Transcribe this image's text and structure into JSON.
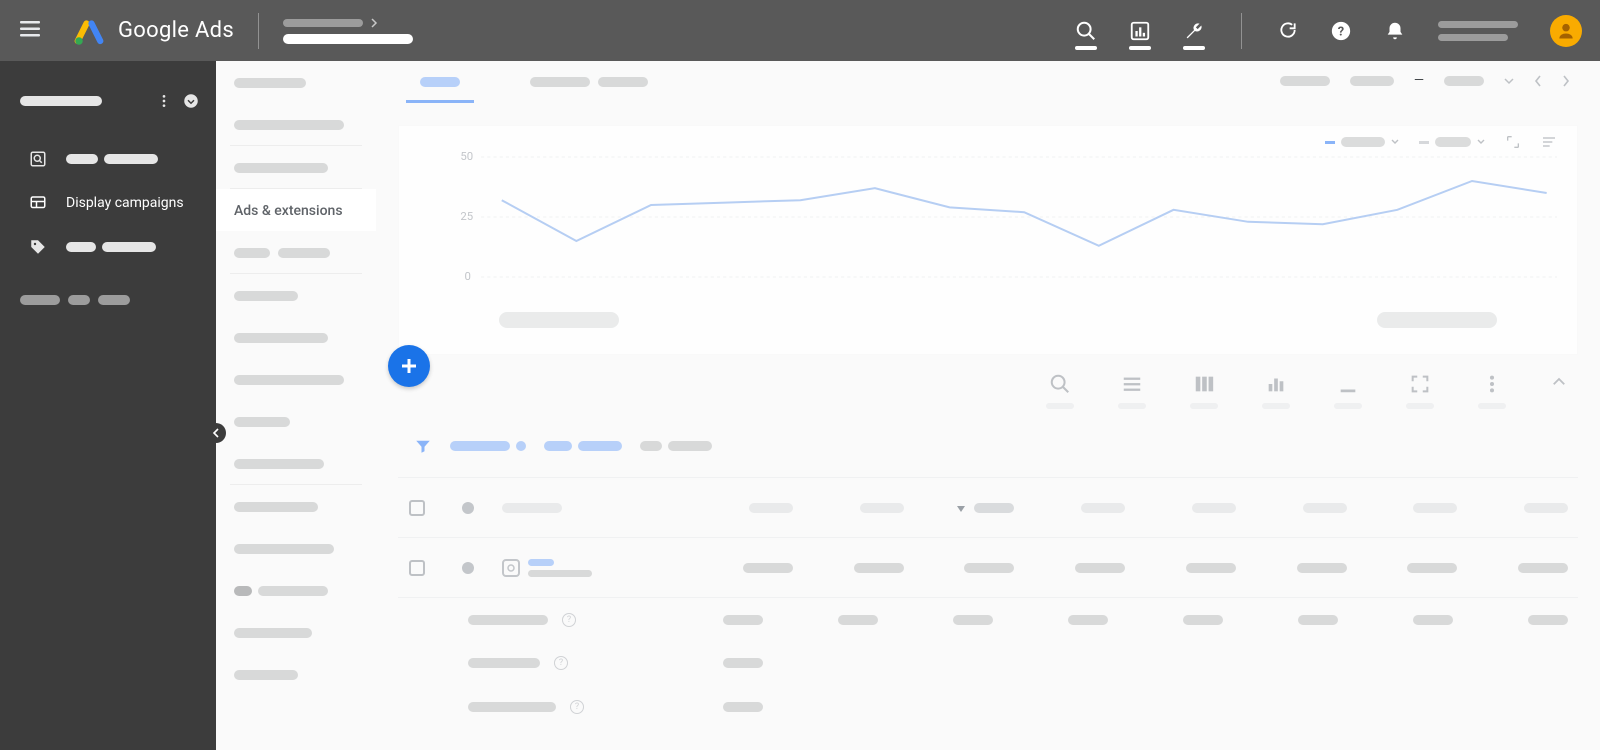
{
  "header": {
    "brand": "Google Ads"
  },
  "sidebar_dark": {
    "display_campaigns_label": "Display campaigns"
  },
  "subnav": {
    "ads_extensions_label": "Ads & extensions"
  },
  "chart_data": {
    "type": "line",
    "x": [
      0,
      1,
      2,
      3,
      4,
      5,
      6,
      7,
      8,
      9,
      10,
      11,
      12,
      13,
      14
    ],
    "values": [
      32,
      15,
      30,
      31,
      32,
      37,
      29,
      27,
      13,
      28,
      23,
      22,
      28,
      40,
      35
    ],
    "ylim": [
      0,
      50
    ],
    "yticks": [
      0,
      25,
      50
    ],
    "title": "",
    "xlabel": "",
    "ylabel": ""
  }
}
